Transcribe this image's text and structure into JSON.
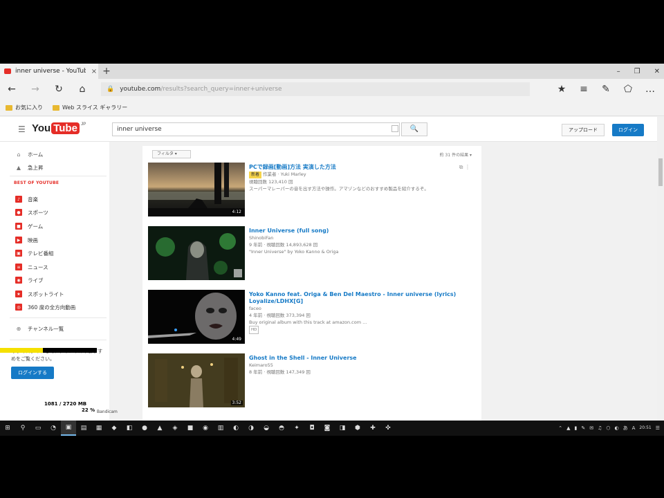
{
  "browser": {
    "tab_title": "inner universe - YouTub",
    "tab_close": "×",
    "new_tab": "+",
    "window_controls": [
      "–",
      "❐",
      "✕"
    ],
    "nav": {
      "back": "←",
      "forward": "→",
      "refresh": "↻",
      "home": "⌂"
    },
    "address": {
      "lock": "🔒",
      "url_host": "youtube.com",
      "url_rest": "/results?search_query=inner+universe"
    },
    "toolbar_right": [
      "★",
      "≡",
      "✎",
      "⬠",
      "…"
    ],
    "favorites": [
      {
        "label": "お気に入り"
      },
      {
        "label": "Web スライス ギャラリー"
      }
    ]
  },
  "youtube": {
    "logo_you": "You",
    "logo_tube": "Tube",
    "logo_region": "JP",
    "search_query": "inner universe",
    "search_icon": "🔍",
    "upload_label": "アップロード",
    "login_label": "ログイン"
  },
  "sidebar": {
    "top_items": [
      {
        "icon": "⌂",
        "label": "ホーム"
      },
      {
        "icon": "▲",
        "label": "急上昇"
      }
    ],
    "section_title": "BEST OF YOUTUBE",
    "best_items": [
      {
        "icon": "♪",
        "label": "音楽"
      },
      {
        "icon": "●",
        "label": "スポーツ"
      },
      {
        "icon": "■",
        "label": "ゲーム"
      },
      {
        "icon": "▶",
        "label": "映画"
      },
      {
        "icon": "▣",
        "label": "テレビ番組"
      },
      {
        "icon": "≡",
        "label": "ニュース"
      },
      {
        "icon": "◉",
        "label": "ライブ"
      },
      {
        "icon": "★",
        "label": "スポットライト"
      },
      {
        "icon": "◎",
        "label": "360 度の全方向動画"
      }
    ],
    "channels_link": {
      "icon": "⊕",
      "label": "チャンネル一覧"
    },
    "signin_note": "今すぐログインして、チャンネルやおすすめをご覧ください。",
    "signin_button": "ログインする"
  },
  "results": {
    "filter_label": "フィルタ ▾",
    "count_label": "約 31 件の結果 ▾",
    "videos": [
      {
        "title": "PCで録画[動画]方法 実演した方法",
        "channel": "作業者 · Yuki Marley",
        "meta": "視聴回数 123,410 回",
        "desc": "スーパーマレーパーの音を出す方法や操作。アマゾンなどのおすすめ製品を紹介するぞ。",
        "duration": "4:12",
        "new_badge": "新着"
      },
      {
        "title": "Inner Universe (full song)",
        "channel": "ShinobiFan",
        "meta": "9 年前 · 視聴回数 14,893,628 回",
        "desc": "\"Inner Universe\" by Yoko Kanno & Origa",
        "duration": "4:26"
      },
      {
        "title": "Yoko Kanno feat. Origa & Ben Del Maestro - Inner universe (lyrics) Loyalize/LDHX[G]",
        "channel": "faceo",
        "meta": "4 年前 · 視聴回数 373,394 回",
        "desc": "Buy original album with this track at amazon.com ...",
        "duration": "4:49",
        "hd": "HD"
      },
      {
        "title": "Ghost in the Shell - Inner Universe",
        "channel": "Keimaro55",
        "meta": "8 年前 · 視聴回数 147,349 回",
        "desc": "",
        "duration": "3:52"
      }
    ],
    "corner_icons": [
      "⧉",
      "⋮"
    ]
  },
  "overlay": {
    "memory": "1081 / 2720 MB",
    "memory2": "22 %",
    "capture_logo": "Bandicam"
  },
  "taskbar": {
    "start": "⊞",
    "apps": [
      "⚲",
      "▭",
      "◔",
      "▣",
      "▤",
      "▦",
      "◆",
      "◧",
      "●",
      "▲",
      "◈",
      "■",
      "◉",
      "▥",
      "◐",
      "◑",
      "◒",
      "◓",
      "✦",
      "◘",
      "◙",
      "◨",
      "⬢",
      "✚",
      "✜"
    ],
    "tray": [
      "⌃",
      "▲",
      "▮",
      "✎",
      "✉",
      "♫",
      "⬡",
      "◐",
      "あ",
      "A",
      "☰"
    ],
    "clock": "20:51"
  }
}
